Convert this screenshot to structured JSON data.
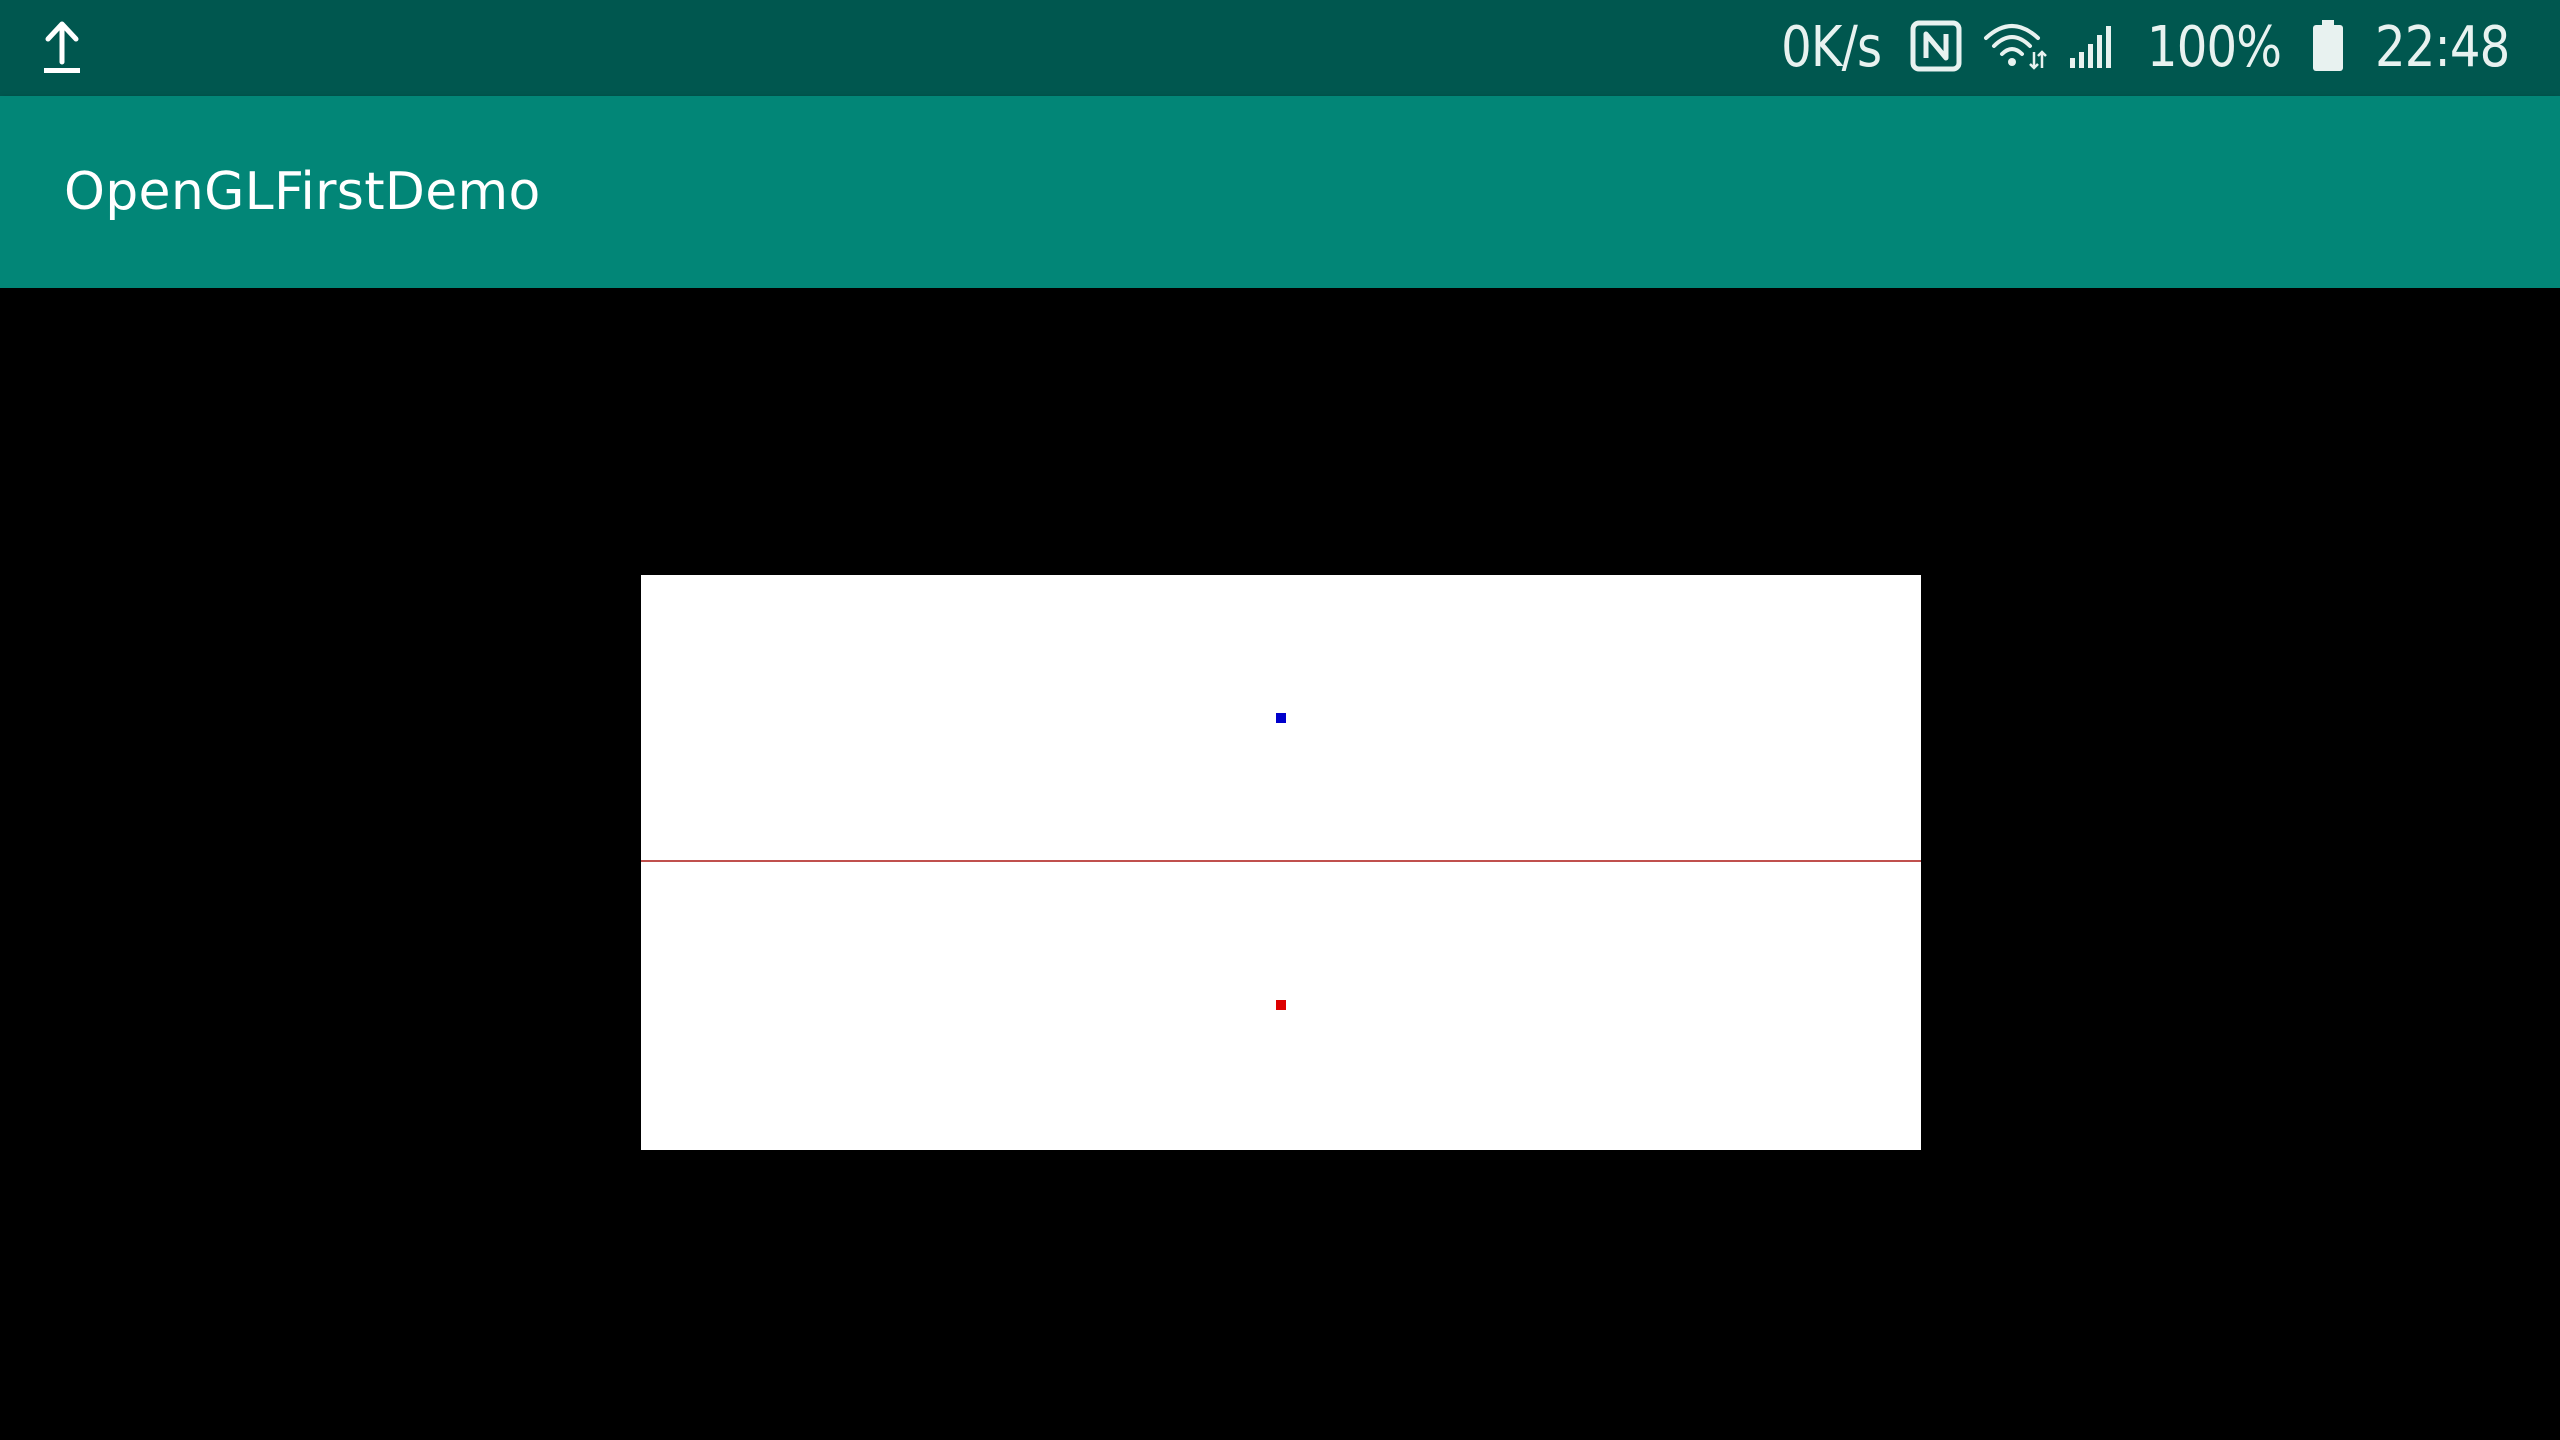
{
  "status_bar": {
    "upload_icon": "upload-icon",
    "network_speed": "0K/s",
    "nfc_icon": "nfc-icon",
    "wifi_icon": "wifi-icon",
    "signal_icon": "cell-signal-icon",
    "battery_percent": "100%",
    "battery_icon": "battery-icon",
    "time": "22:48"
  },
  "app_bar": {
    "title": "OpenGLFirstDemo"
  },
  "gl_view": {
    "background_color": "#ffffff",
    "line_color": "#c0504d",
    "points": [
      {
        "color": "#0000cc"
      },
      {
        "color": "#dd0000"
      }
    ]
  },
  "colors": {
    "status_bar": "#00574F",
    "app_bar": "#028677",
    "content_background": "#000000"
  }
}
